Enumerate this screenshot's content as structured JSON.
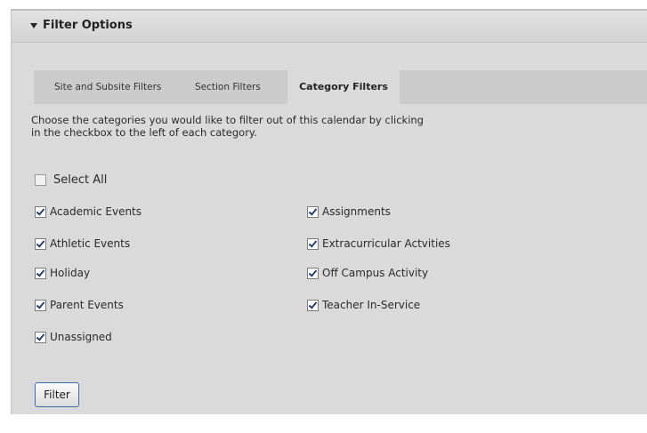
{
  "panel": {
    "title": "Filter Options",
    "collapse_icon": "triangle-down-icon"
  },
  "tabs": [
    {
      "label": "Site and Subsite Filters",
      "active": false
    },
    {
      "label": "Section Filters",
      "active": false
    },
    {
      "label": "Category Filters",
      "active": true
    }
  ],
  "instructions": {
    "line1": "Choose the categories you would like to filter out of this calendar by clicking",
    "line2": "in the checkbox to the left of each category."
  },
  "select_all": {
    "label": "Select All",
    "checked": false
  },
  "categories": [
    {
      "label": "Academic Events",
      "checked": true
    },
    {
      "label": "Assignments",
      "checked": true
    },
    {
      "label": "Athletic Events",
      "checked": true
    },
    {
      "label": "Extracurricular Actvities",
      "checked": true
    },
    {
      "label": "Holiday",
      "checked": true
    },
    {
      "label": "Off Campus Activity",
      "checked": true
    },
    {
      "label": "Parent Events",
      "checked": true
    },
    {
      "label": "Teacher In-Service",
      "checked": true
    },
    {
      "label": "Unassigned",
      "checked": true
    }
  ],
  "filter_button": {
    "label": "Filter"
  }
}
